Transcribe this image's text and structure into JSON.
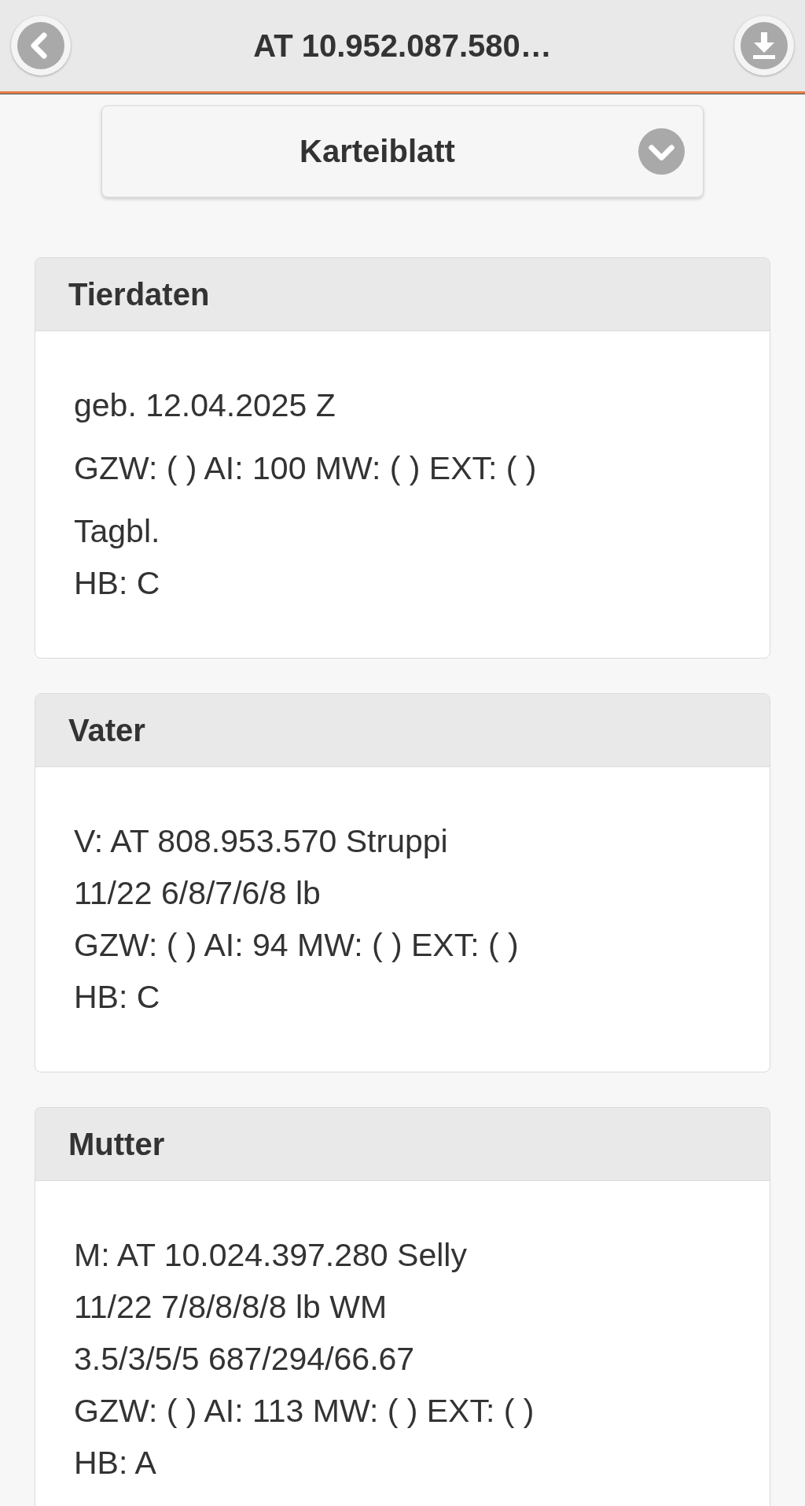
{
  "header": {
    "title": "AT 10.952.087.580…"
  },
  "section_select": {
    "label": "Karteiblatt"
  },
  "cards": [
    {
      "title": "Tierdaten",
      "paragraphs": [
        {
          "lines": [
            "geb. 12.04.2025 Z"
          ]
        },
        {
          "lines": [
            "GZW: ( ) AI: 100 MW: ( ) EXT: ( )"
          ]
        },
        {
          "lines": [
            "Tagbl.",
            "HB: C"
          ]
        }
      ]
    },
    {
      "title": "Vater",
      "paragraphs": [
        {
          "lines": [
            "V: AT 808.953.570 Struppi",
            "11/22 6/8/7/6/8 lb",
            "GZW: ( ) AI: 94 MW: ( ) EXT: ( )",
            "HB: C"
          ]
        }
      ]
    },
    {
      "title": "Mutter",
      "paragraphs": [
        {
          "lines": [
            "M: AT 10.024.397.280 Selly",
            "11/22 7/8/8/8/8 lb WM",
            "3.5/3/5/5 687/294/66.67",
            "GZW: ( ) AI: 113 MW: ( ) EXT: ( )",
            "HB: A"
          ]
        }
      ]
    }
  ]
}
